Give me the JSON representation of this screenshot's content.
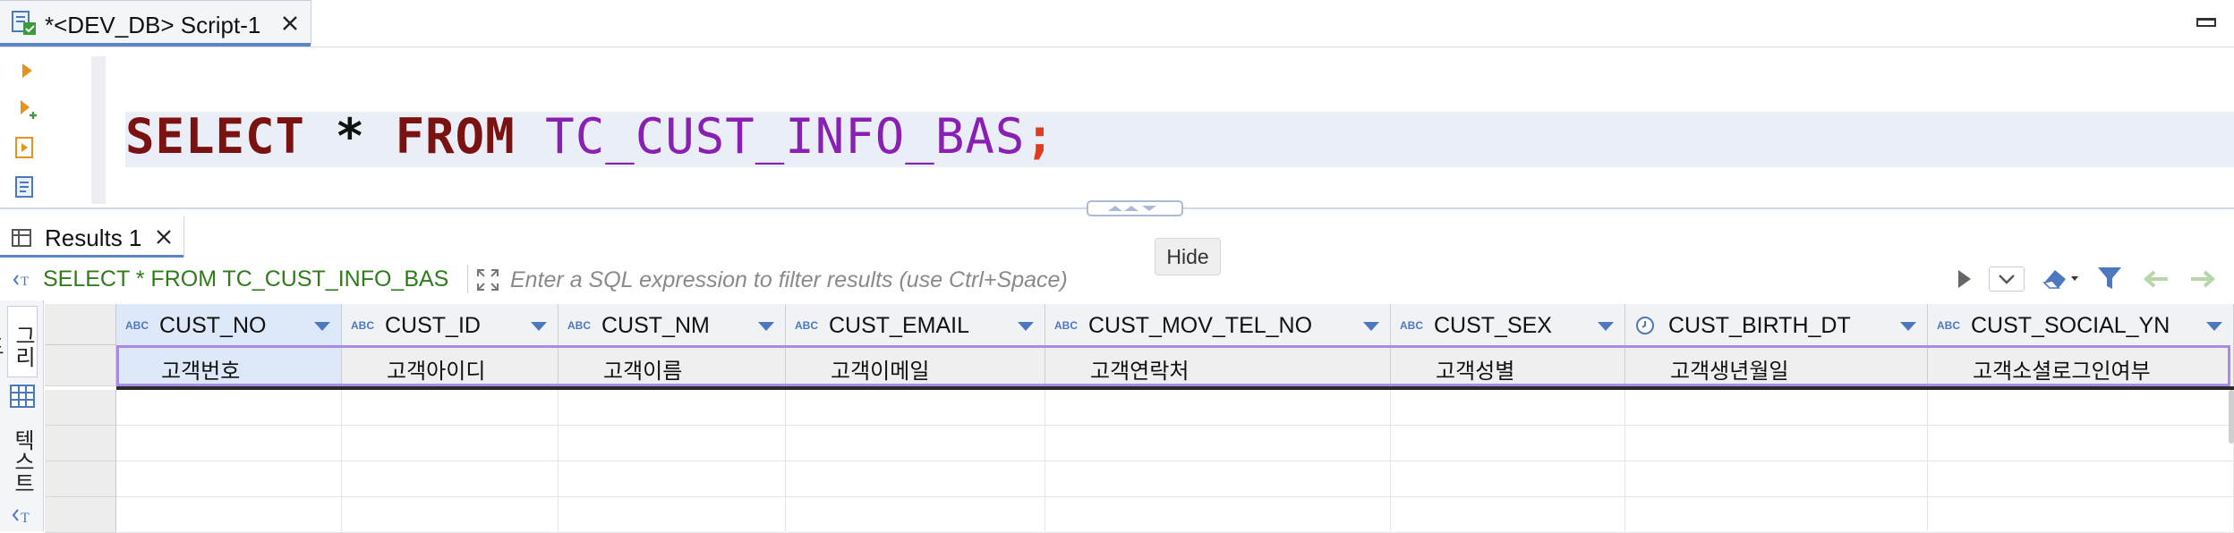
{
  "editor_tab": {
    "title": "*<DEV_DB> Script-1",
    "script_icon": "sql-script-icon",
    "close_icon": "close-icon"
  },
  "window": {
    "minimize_icon": "minimize-icon"
  },
  "editor": {
    "gutter_icons": [
      "execute-statement-icon",
      "execute-new-tab-icon",
      "execute-script-icon",
      "explain-plan-icon"
    ],
    "sql": {
      "kw_select": "SELECT",
      "star": " * ",
      "kw_from": "FROM",
      "table": " TC_CUST_INFO_BAS",
      "semicolon": ";"
    }
  },
  "results_tab": {
    "label": "Results 1",
    "icon": "grid-icon",
    "close_icon": "close-icon"
  },
  "filter": {
    "query_text": "SELECT * FROM TC_CUST_INFO_BAS",
    "placeholder": "Enter a SQL expression to filter results (use Ctrl+Space)",
    "value": "",
    "icons": [
      "query-icon",
      "expand-icon",
      "apply-filter-icon",
      "filter-history-icon",
      "clear-filter-icon",
      "filter-funnel-icon",
      "back-icon",
      "forward-icon"
    ]
  },
  "tooltip": {
    "text": "Hide"
  },
  "view_tabs": {
    "grid_label": "그리드",
    "text_label": "텍스트"
  },
  "grid": {
    "type_badge": "ABC",
    "columns": [
      {
        "name": "CUST_NO",
        "type": "string"
      },
      {
        "name": "CUST_ID",
        "type": "string"
      },
      {
        "name": "CUST_NM",
        "type": "string"
      },
      {
        "name": "CUST_EMAIL",
        "type": "string"
      },
      {
        "name": "CUST_MOV_TEL_NO",
        "type": "string"
      },
      {
        "name": "CUST_SEX",
        "type": "string"
      },
      {
        "name": "CUST_BIRTH_DT",
        "type": "date"
      },
      {
        "name": "CUST_SOCIAL_YN",
        "type": "string"
      }
    ],
    "rows": [
      [
        "고객번호",
        "고객아이디",
        "고객이름",
        "고객이메일",
        "고객연락처",
        "고객성별",
        "고객생년월일",
        "고객소셜로그인여부"
      ]
    ]
  },
  "colors": {
    "keyword": "#7a1212",
    "table_name": "#8a1fb3",
    "semicolon": "#e23a1e",
    "filter_query": "#2e7d1a",
    "accent": "#5b86c5",
    "row_outline": "#a98be5"
  }
}
